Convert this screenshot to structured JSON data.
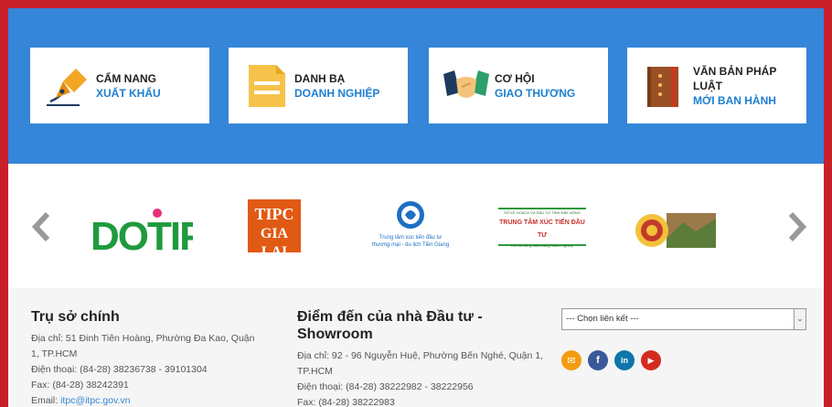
{
  "cards": [
    {
      "line1": "CẨM NANG",
      "line2": "XUẤT KHẨU",
      "icon": "pen-icon"
    },
    {
      "line1": "DANH BẠ",
      "line2": "DOANH NGHIỆP",
      "icon": "document-icon"
    },
    {
      "line1": "CƠ HỘI",
      "line2": "GIAO THƯƠNG",
      "icon": "handshake-icon"
    },
    {
      "line1": "VĂN BẢN PHÁP LUẬT",
      "line2": "MỚI BAN HÀNH",
      "icon": "book-icon"
    }
  ],
  "partners": {
    "dotip": "DOTIP",
    "tipc_line1": "TIPC",
    "tipc_line2": "GIA LAI",
    "tiengiang_line1": "Trung tâm xúc tiến đầu tư",
    "tiengiang_line2": "thương mại - du lịch Tiền Giang",
    "daknong_header": "SỞ KẾ HOẠCH VÀ ĐẦU TƯ TỈNH ĐĂK NÔNG",
    "daknong_title": "TRUNG TÂM XÚC TIẾN ĐẦU TƯ",
    "daknong_sub": "Kết nối đồng hành cùng doanh nghiệp"
  },
  "footer": {
    "hq": {
      "title": "Trụ sở chính",
      "address": "Địa chỉ: 51 Đinh Tiên Hoàng, Phường Đa Kao, Quận 1, TP.HCM",
      "phone": "Điện thoại: (84-28) 38236738 - 39101304",
      "fax": "Fax: (84-28) 38242391",
      "email_label": "Email: ",
      "email": "itpc@itpc.gov.vn"
    },
    "showroom": {
      "title": "Điểm đến của nhà Đầu tư - Showroom",
      "address": "Địa chỉ: 92 - 96 Nguyễn Huệ, Phường Bến Nghé, Quận 1, TP.HCM",
      "phone": "Điện thoại: (84-28) 38222982 - 38222956",
      "fax": "Fax: (84-28) 38222983"
    },
    "select_value": "--- Chọn liên kết ---",
    "social": [
      {
        "icon": "email-icon",
        "color": "#f39c12",
        "glyph": "✉"
      },
      {
        "icon": "facebook-icon",
        "color": "#3b5998",
        "glyph": "f"
      },
      {
        "icon": "linkedin-icon",
        "color": "#0e76a8",
        "glyph": "in"
      },
      {
        "icon": "youtube-icon",
        "color": "#d52b1e",
        "glyph": "▶"
      }
    ]
  },
  "colors": {
    "brand_blue": "#3585d9",
    "frame_red": "#c8202a",
    "link_blue": "#1d7fd0"
  }
}
